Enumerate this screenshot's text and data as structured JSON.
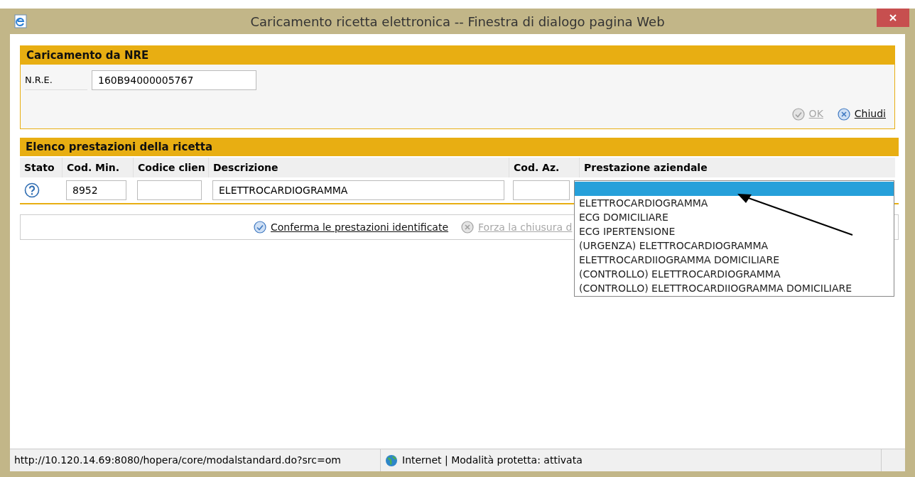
{
  "window": {
    "title": "Caricamento ricetta elettronica -- Finestra di dialogo pagina Web"
  },
  "nre_section": {
    "title": "Caricamento da NRE",
    "field_label": "N.R.E.",
    "field_value": "160B94000005767",
    "buttons": [
      {
        "label": "OK",
        "disabled": true,
        "kind": "ok"
      },
      {
        "label": "Chiudi",
        "disabled": false,
        "kind": "close"
      }
    ]
  },
  "services_section": {
    "title": "Elenco prestazioni della ricetta",
    "columns": [
      "Stato",
      "Cod. Min.",
      "Codice clien",
      "Descrizione",
      "Cod. Az.",
      "Prestazione aziendale"
    ],
    "rows": [
      {
        "cod_min": "8952",
        "descrizione": "ELETTROCARDIOGRAMMA"
      }
    ],
    "buttons": [
      {
        "label": "Conferma le prestazioni identificate",
        "disabled": false,
        "kind": "ok"
      },
      {
        "label": "Forza la chiusura d",
        "disabled": true,
        "kind": "close"
      }
    ]
  },
  "dropdown": {
    "options": [
      {
        "selected": true
      },
      {
        "label": "ELETTROCARDIOGRAMMA",
        "selected": false
      },
      {
        "label": "ECG DOMICILIARE",
        "selected": false
      },
      {
        "label": "ECG IPERTENSIONE",
        "selected": false
      },
      {
        "label": "(URGENZA) ELETTROCARDIOGRAMMA",
        "selected": false
      },
      {
        "label": "ELETTROCARDIIOGRAMMA DOMICILIARE",
        "selected": false
      },
      {
        "label": "(CONTROLLO) ELETTROCARDIOGRAMMA",
        "selected": false
      },
      {
        "label": "(CONTROLLO) ELETTROCARDIIOGRAMMA DOMICILIARE",
        "selected": false
      }
    ]
  },
  "status_bar": {
    "url": "http://10.120.14.69:8080/hopera/core/modalstandard.do?src=om",
    "zone": "Internet | Modalità protetta: attivata"
  }
}
